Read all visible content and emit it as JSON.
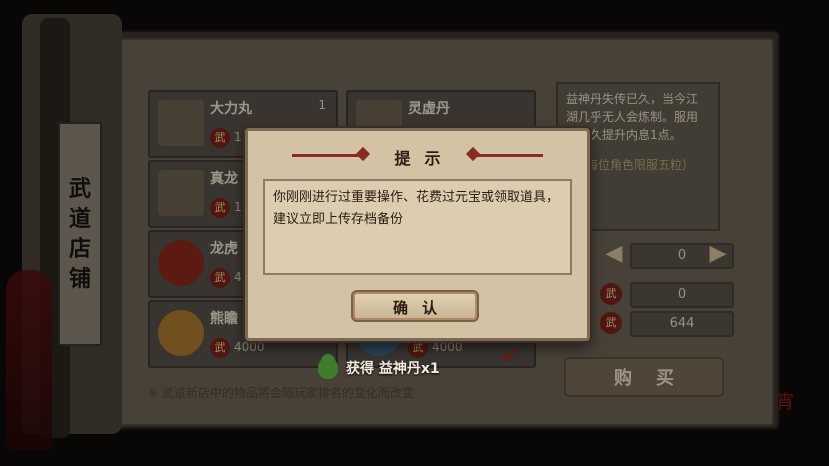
{
  "shop": {
    "title_chars": [
      "武",
      "道",
      "店",
      "铺"
    ],
    "coin_glyph": "武",
    "note": "※ 武道新店中的物品将会随玩家排名的变化而改变",
    "items": [
      {
        "name": "大力丸",
        "qty": "1",
        "price": "1"
      },
      {
        "name": "灵虚丹",
        "qty": "",
        "price": ""
      },
      {
        "name": "真龙",
        "qty": "",
        "price": "1"
      },
      {
        "name": "龙虎",
        "qty": "",
        "price": "4"
      },
      {
        "name": "熊瞻",
        "qty": "",
        "price": "4000"
      },
      {
        "name": "",
        "qty": "",
        "price": "4000"
      }
    ]
  },
  "detail": {
    "desc_lines": [
      "益神丹失传已久，当今江",
      "湖几乎无人会炼制。服用",
      "可永久提升内息1点。"
    ],
    "desc_note": "每位角色限服五粒）",
    "quantity": "0",
    "cost": "0",
    "owned": "644",
    "arrow_left": "◀",
    "arrow_right": "▶",
    "buy_label": "购买"
  },
  "dialog": {
    "title": "提示",
    "message": "你刚刚进行过重要操作、花费过元宝或领取道具，建议立即上传存档备份",
    "confirm_label": "确认"
  },
  "toast": {
    "text": "获得 益神丹x1"
  },
  "seal": "宵"
}
